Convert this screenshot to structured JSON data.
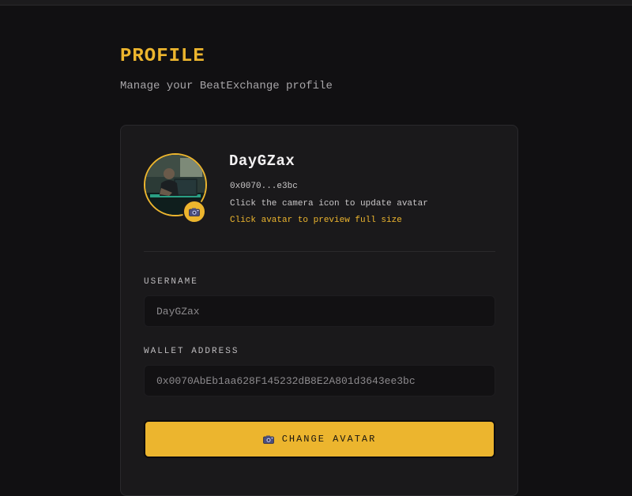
{
  "header": {
    "title": "PROFILE",
    "subtitle": "Manage your BeatExchange profile"
  },
  "profile": {
    "display_name": "DayGZax",
    "short_address": "0x0070...e3bc",
    "avatar_hint": "Click the camera icon to update avatar",
    "preview_hint": "Click avatar to preview full size",
    "camera_icon": "camera-icon"
  },
  "form": {
    "username_label": "USERNAME",
    "username_value": "DayGZax",
    "wallet_label": "WALLET ADDRESS",
    "wallet_value": "0x0070AbEb1aa628F145232dB8E2A801d3643ee3bc"
  },
  "actions": {
    "change_avatar_label": "CHANGE AVATAR",
    "change_avatar_icon": "camera-icon"
  },
  "colors": {
    "accent": "#ecb52e",
    "background": "#111012",
    "card": "#1a191b"
  }
}
